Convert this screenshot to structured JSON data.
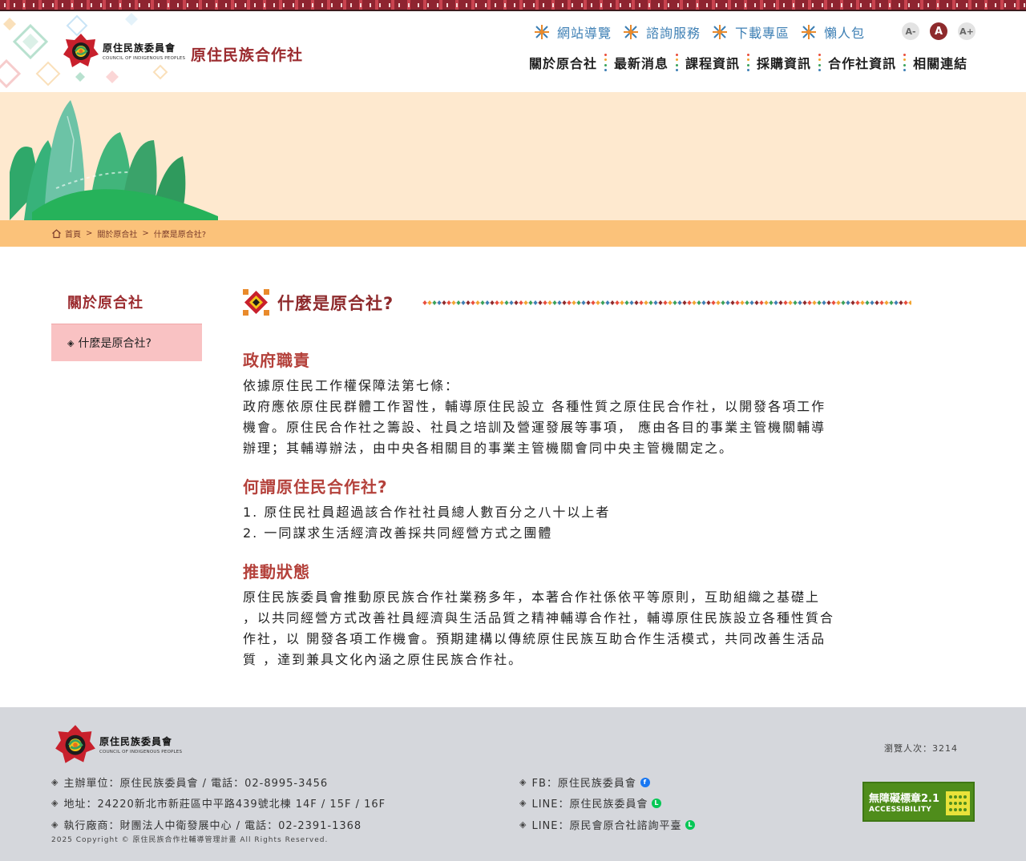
{
  "header": {
    "logo_cn": "原住民族委員會",
    "logo_en": "COUNCIL OF INDIGENOUS PEOPLES",
    "site_title": "原住民族合作社",
    "util_nav": [
      "網站導覽",
      "諮詢服務",
      "下載專區",
      "懶人包"
    ],
    "font_controls": [
      "A-",
      "A",
      "A+"
    ],
    "main_nav": [
      "關於原合社",
      "最新消息",
      "課程資訊",
      "採購資訊",
      "合作社資訊",
      "相關連結"
    ]
  },
  "breadcrumb": [
    "首頁",
    "關於原合社",
    "什麼是原合社?"
  ],
  "sidebar": {
    "title": "關於原合社",
    "items": [
      {
        "label": "什麼是原合社?"
      }
    ]
  },
  "content": {
    "title": "什麼是原合社?",
    "sections": [
      {
        "heading": "政府職責",
        "lines": [
          "依據原住民工作權保障法第七條：",
          "政府應依原住民群體工作習性，輔導原住民設立 各種性質之原住民合作社，以開發各項工作",
          "機會。原住民合作社之籌設、社員之培訓及營運發展等事項， 應由各目的事業主管機關輔導",
          "辦理；其輔導辦法，由中央各相關目的事業主管機關會同中央主管機關定之。"
        ]
      },
      {
        "heading": "何謂原住民合作社?",
        "lines": [
          "1. 原住民社員超過該合作社社員總人數百分之八十以上者",
          "2. 一同謀求生活經濟改善採共同經營方式之團體"
        ]
      },
      {
        "heading": "推動狀態",
        "lines": [
          "原住民族委員會推動原民族合作社業務多年，本著合作社係依平等原則，互助組織之基礎上",
          "，以共同經營方式改善社員經濟與生活品質之精神輔導合作社，輔導原住民族設立各種性質合",
          "作社，以 開發各項工作機會。預期建構以傳統原住民族互助合作生活模式，共同改善生活品",
          "質 ，達到兼具文化內涵之原住民族合作社。"
        ]
      }
    ]
  },
  "footer": {
    "logo_cn": "原住民族委員會",
    "logo_en": "COUNCIL OF INDIGENOUS PEOPLES",
    "left_info": [
      "主辦單位：原住民族委員會 / 電話：02-8995-3456",
      "地址：24220新北市新莊區中平路439號北棟 14F / 15F / 16F",
      "執行廠商：財團法人中衛發展中心 / 電話：02-2391-1368"
    ],
    "right_info": [
      "FB：原住民族委員會",
      "LINE：原住民族委員會",
      "LINE：原民會原合社諮詢平臺"
    ],
    "copyright": "2025 Copyright © 原住民族合作社輔導管理計畫 All Rights Reserved.",
    "visits": "瀏覽人次：3214",
    "badge_title": "無障礙標章2.1",
    "badge_sub": "ACCESSIBILITY"
  },
  "colors": {
    "accent": "#9b2b2f",
    "util_link": "#3d7fb4",
    "banner_bg": "#fee9cf",
    "breadcrumb_bg": "#fbc27a",
    "sidebar_active": "#f9c2c3",
    "footer_bg": "#d5d7dc"
  },
  "icons": [
    "home-icon",
    "star-pattern-icon",
    "diamond-bullet-icon",
    "facebook-icon",
    "line-icon"
  ]
}
